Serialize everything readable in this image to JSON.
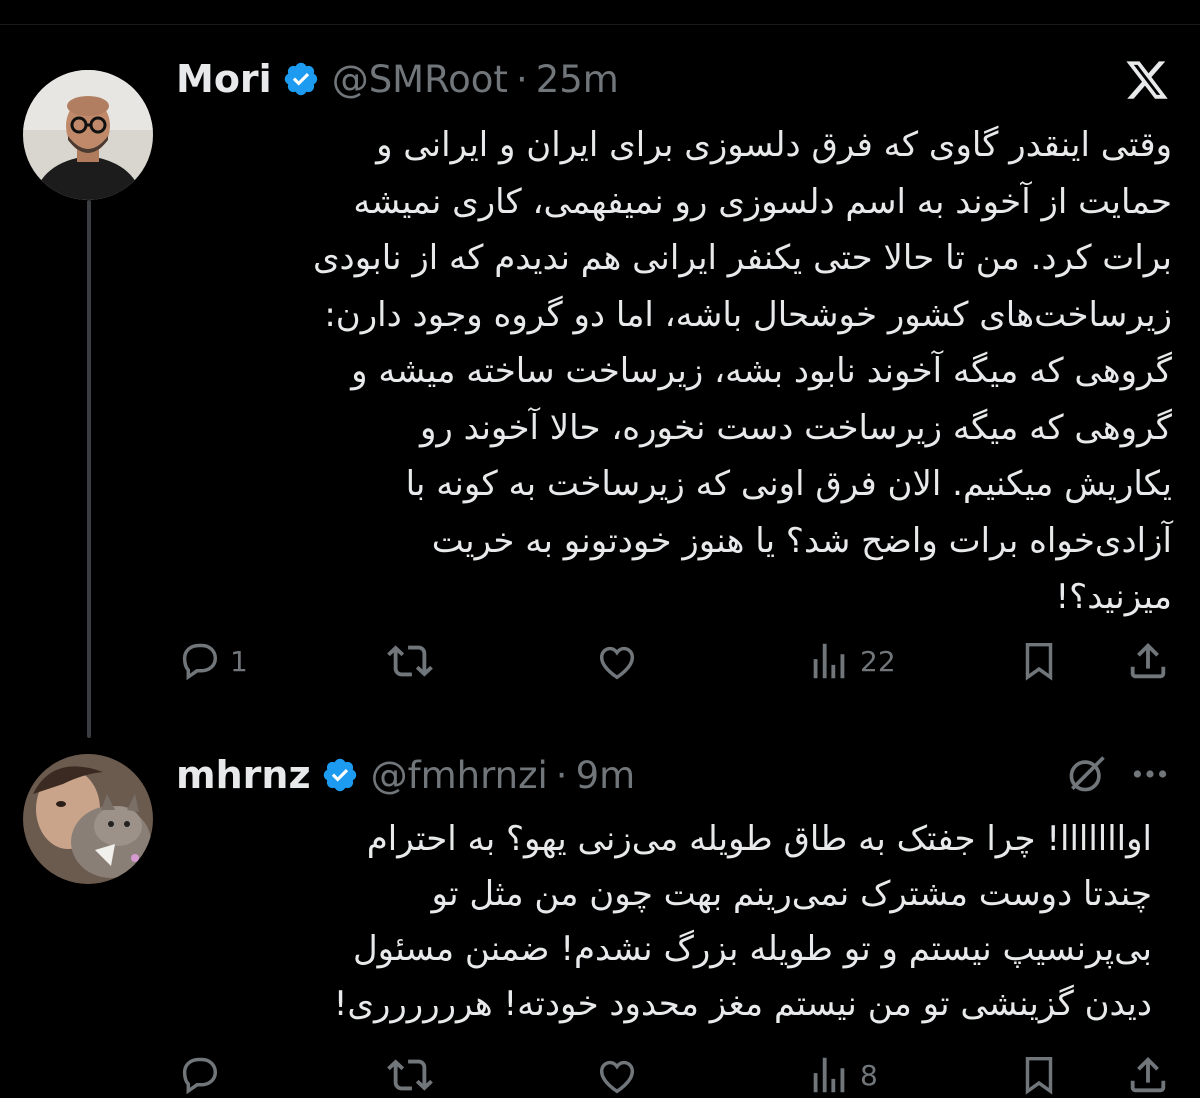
{
  "tweet1": {
    "name": "Mori",
    "handle": "@SMRoot",
    "separator": "·",
    "time": "25m",
    "lines": [
      "وقتی اینقدر گاوی که فرق دلسوزی برای ایران و ایرانی و",
      "حمایت از آخوند به اسم دلسوزی رو نمیفهمی، کاری نمیشه",
      "برات کرد. من تا حالا حتی یکنفر ایرانی هم ندیدم که از نابودی",
      "زیرساخت‌های کشور خوشحال باشه، اما دو گروه وجود دارن:",
      "گروهی که میگه آخوند نابود بشه، زیرساخت ساخته میشه و",
      "گروهی که میگه زیرساخت دست نخوره، حالا آخوند رو",
      "یکاریش میکنیم. الان فرق اونی که زیرساخت به کونه با",
      "آزادی‌خواه برات واضح شد؟ یا هنوز خودتونو به خریت",
      "میزنید؟!"
    ],
    "actions": {
      "reply_count": "1",
      "views_count": "22"
    }
  },
  "tweet2": {
    "name": "mhrnz",
    "handle": "@fmhrnzi",
    "separator": "·",
    "time": "9m",
    "lines": [
      "اوااااااا! چرا جفتک به طاق طویله می‌زنی یهو؟ به احترام",
      "چندتا دوست مشترک نمی‌رینم بهت چون من مثل تو",
      "بی‌پرنسیپ نیستم و تو طویله بزرگ نشدم! ضمنن مسئول",
      "دیدن گزینشی تو من نیستم مغز محدود خودته! هرررررری!"
    ],
    "actions": {
      "views_count": "8"
    }
  },
  "icons": {
    "platform": "x-logo",
    "verified_color": "#1d9bf0",
    "reply": "reply-icon",
    "retweet": "retweet-icon",
    "like": "like-icon",
    "views": "views-icon",
    "bookmark": "bookmark-icon",
    "share": "share-icon",
    "grok": "grok-icon",
    "more": "more-icon"
  }
}
